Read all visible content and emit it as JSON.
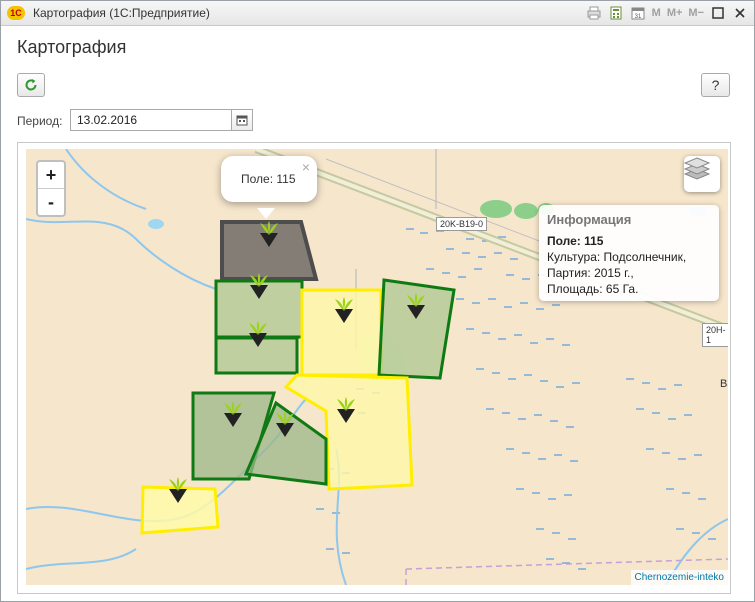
{
  "window": {
    "title": "Картография  (1С:Предприятие)",
    "logo_text": "1С",
    "toolbar_icons": [
      "print-icon",
      "calculator-icon",
      "calendar-icon"
    ],
    "memory_buttons": [
      "M",
      "M+",
      "M−"
    ]
  },
  "page": {
    "title": "Картография",
    "help_label": "?"
  },
  "filter": {
    "period_label": "Период:",
    "period_value": "13.02.2016"
  },
  "map": {
    "zoom_in": "+",
    "zoom_out": "-",
    "popup": {
      "text": "Поле: 115",
      "close": "×"
    },
    "info": {
      "title": "Информация",
      "field": "Поле: 115",
      "crop": "Культура: Подсолнечник,",
      "batch": "Партия: 2015 г.,",
      "area": "Площадь: 65 Га."
    },
    "road_labels": [
      "20K-B19-0",
      "20H-1"
    ],
    "town_label": "Ва",
    "attribution": "Chernozemie-inteko",
    "colors": {
      "selected_field": "#5e5e5e",
      "green_field": "#0f7a14",
      "yellow_field": "#ffee00",
      "water": "#3c8fd6",
      "land": "#f6e6cc"
    }
  }
}
